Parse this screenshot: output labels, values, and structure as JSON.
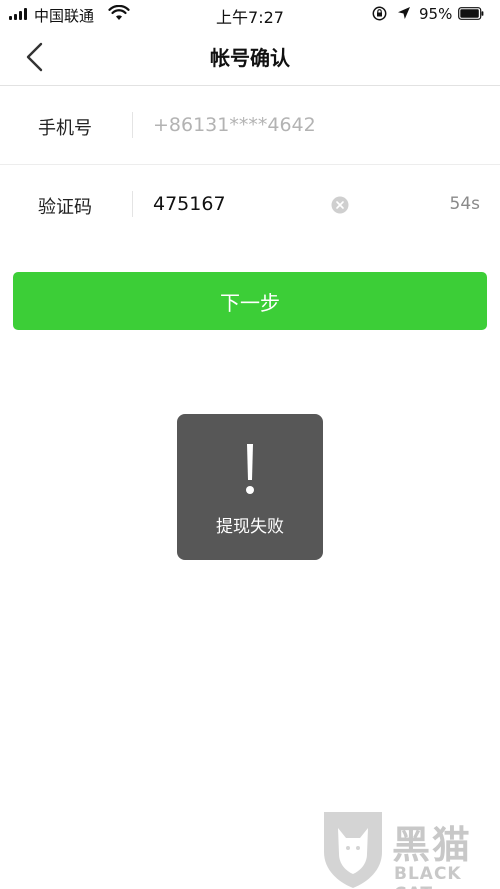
{
  "status_bar": {
    "carrier": "中国联通",
    "time": "上午7:27",
    "battery": "95%",
    "icons": [
      "signal-icon",
      "wifi-icon",
      "rotation-lock-icon",
      "location-icon",
      "battery-icon"
    ]
  },
  "nav": {
    "title": "帐号确认",
    "back_icon": "chevron-left-icon"
  },
  "form": {
    "phone": {
      "label": "手机号",
      "placeholder": "+86131****4642"
    },
    "code": {
      "label": "验证码",
      "value": "475167",
      "countdown": "54s",
      "clear_icon": "clear-circle-icon"
    }
  },
  "next_button": {
    "label": "下一步"
  },
  "toast": {
    "icon": "exclamation-icon",
    "text": "提现失败"
  },
  "watermark": {
    "title": "黑猫",
    "subtitle": "BLACK CAT"
  },
  "colors": {
    "primary_green": "#3cce37",
    "toast_bg": "#575757",
    "placeholder_gray": "#b3b3b3",
    "countdown_gray": "#8a8a8a"
  }
}
